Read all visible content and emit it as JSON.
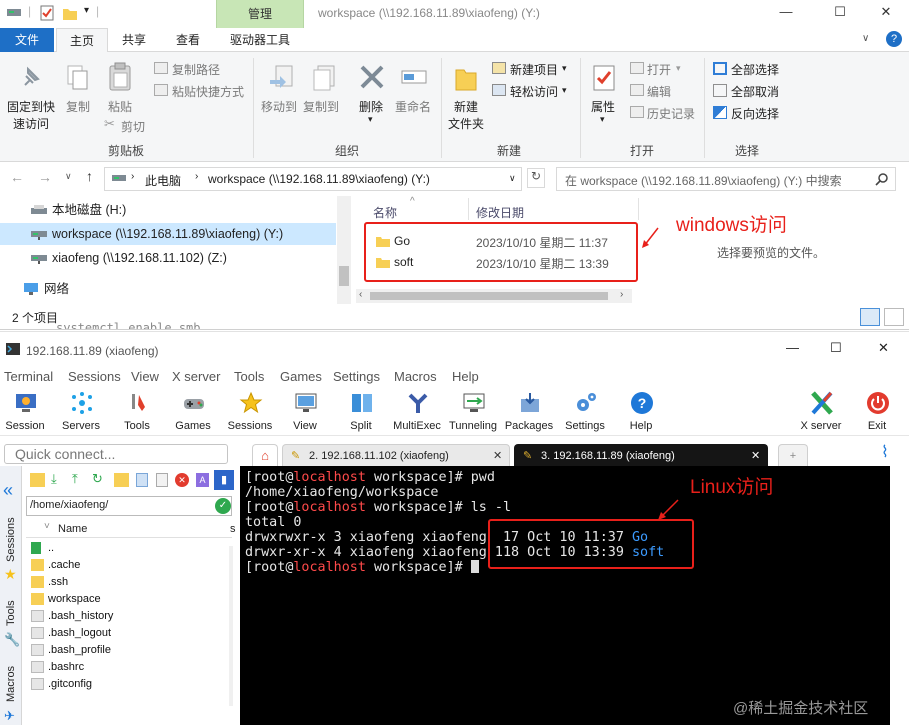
{
  "explorer": {
    "manage_tab": "管理",
    "title": "workspace (\\\\192.168.11.89\\xiaofeng) (Y:)",
    "ribbon_tabs": [
      "文件",
      "主页",
      "共享",
      "查看",
      "驱动器工具"
    ],
    "clipboard": {
      "pin": [
        "固定到快",
        "速访问"
      ],
      "copy": "复制",
      "paste": "粘贴",
      "copy_path": "复制路径",
      "paste_shortcut": "粘贴快捷方式",
      "cut": "剪切",
      "label": "剪贴板"
    },
    "organize": {
      "move_to": "移动到",
      "copy_to": "复制到",
      "delete": "删除",
      "rename": "重命名",
      "label": "组织"
    },
    "new": {
      "new_folder": [
        "新建",
        "文件夹"
      ],
      "new_item": "新建项目",
      "easy_access": "轻松访问",
      "label": "新建"
    },
    "open": {
      "properties": "属性",
      "open": "打开",
      "edit": "编辑",
      "history": "历史记录",
      "label": "打开"
    },
    "select": {
      "select_all": "全部选择",
      "select_none": "全部取消",
      "invert": "反向选择",
      "label": "选择"
    },
    "address": {
      "this_pc": "此电脑",
      "current": "workspace (\\\\192.168.11.89\\xiaofeng) (Y:)",
      "search_placeholder": "在 workspace (\\\\192.168.11.89\\xiaofeng) (Y:) 中搜索"
    },
    "nav_items": [
      "本地磁盘 (H:)",
      "workspace (\\\\192.168.11.89\\xiaofeng) (Y:)",
      "xiaofeng (\\\\192.168.11.102) (Z:)",
      "网络"
    ],
    "columns": {
      "name": "名称",
      "modified": "修改日期"
    },
    "files": [
      {
        "name": "Go",
        "modified": "2023/10/10 星期二 11:37"
      },
      {
        "name": "soft",
        "modified": "2023/10/10 星期二 13:39"
      }
    ],
    "preview_hint": "选择要预览的文件。",
    "status": "2 个项目",
    "bleed_text": "systemctl enable smb",
    "annotation": "windows访问"
  },
  "moba": {
    "title": "192.168.11.89 (xiaofeng)",
    "menu": [
      "Terminal",
      "Sessions",
      "View",
      "X server",
      "Tools",
      "Games",
      "Settings",
      "Macros",
      "Help"
    ],
    "toolbar": [
      "Session",
      "Servers",
      "Tools",
      "Games",
      "Sessions",
      "View",
      "Split",
      "MultiExec",
      "Tunneling",
      "Packages",
      "Settings",
      "Help",
      "X server",
      "Exit"
    ],
    "quick_connect": "Quick connect...",
    "tabs": [
      "2. 192.168.11.102 (xiaofeng)",
      "3. 192.168.11.89 (xiaofeng)"
    ],
    "side_labels": [
      "Sessions",
      "Tools",
      "Macros"
    ],
    "sftp_path": "/home/xiaofeng/",
    "sftp_header": "Name",
    "sftp_items": [
      "..",
      ".cache",
      ".ssh",
      "workspace",
      ".bash_history",
      ".bash_logout",
      ".bash_profile",
      ".bashrc",
      ".gitconfig"
    ],
    "terminal": {
      "user": "root",
      "host": "localhost",
      "dir": "workspace",
      "cmd1": "pwd",
      "out1": "/home/xiaofeng/workspace",
      "cmd2": "ls -l",
      "total": "total 0",
      "row1_prefix": "drwxrwxr-x 3 xiaofeng xiaofeng  17 Oct 10 11:37 ",
      "row1_name": "Go",
      "row2_prefix": "drwxr-xr-x 4 xiaofeng xiaofeng 118 Oct 10 13:39 ",
      "row2_name": "soft"
    },
    "annotation": "Linux访问"
  },
  "watermark": "@稀土掘金技术社区"
}
